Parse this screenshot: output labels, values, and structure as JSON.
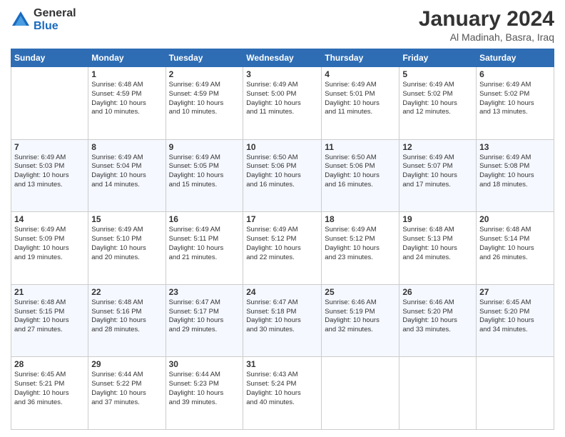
{
  "header": {
    "logo_general": "General",
    "logo_blue": "Blue",
    "month_title": "January 2024",
    "subtitle": "Al Madinah, Basra, Iraq"
  },
  "days_of_week": [
    "Sunday",
    "Monday",
    "Tuesday",
    "Wednesday",
    "Thursday",
    "Friday",
    "Saturday"
  ],
  "weeks": [
    [
      {
        "day": "",
        "lines": []
      },
      {
        "day": "1",
        "lines": [
          "Sunrise: 6:48 AM",
          "Sunset: 4:59 PM",
          "Daylight: 10 hours",
          "and 10 minutes."
        ]
      },
      {
        "day": "2",
        "lines": [
          "Sunrise: 6:49 AM",
          "Sunset: 4:59 PM",
          "Daylight: 10 hours",
          "and 10 minutes."
        ]
      },
      {
        "day": "3",
        "lines": [
          "Sunrise: 6:49 AM",
          "Sunset: 5:00 PM",
          "Daylight: 10 hours",
          "and 11 minutes."
        ]
      },
      {
        "day": "4",
        "lines": [
          "Sunrise: 6:49 AM",
          "Sunset: 5:01 PM",
          "Daylight: 10 hours",
          "and 11 minutes."
        ]
      },
      {
        "day": "5",
        "lines": [
          "Sunrise: 6:49 AM",
          "Sunset: 5:02 PM",
          "Daylight: 10 hours",
          "and 12 minutes."
        ]
      },
      {
        "day": "6",
        "lines": [
          "Sunrise: 6:49 AM",
          "Sunset: 5:02 PM",
          "Daylight: 10 hours",
          "and 13 minutes."
        ]
      }
    ],
    [
      {
        "day": "7",
        "lines": [
          "Sunrise: 6:49 AM",
          "Sunset: 5:03 PM",
          "Daylight: 10 hours",
          "and 13 minutes."
        ]
      },
      {
        "day": "8",
        "lines": [
          "Sunrise: 6:49 AM",
          "Sunset: 5:04 PM",
          "Daylight: 10 hours",
          "and 14 minutes."
        ]
      },
      {
        "day": "9",
        "lines": [
          "Sunrise: 6:49 AM",
          "Sunset: 5:05 PM",
          "Daylight: 10 hours",
          "and 15 minutes."
        ]
      },
      {
        "day": "10",
        "lines": [
          "Sunrise: 6:50 AM",
          "Sunset: 5:06 PM",
          "Daylight: 10 hours",
          "and 16 minutes."
        ]
      },
      {
        "day": "11",
        "lines": [
          "Sunrise: 6:50 AM",
          "Sunset: 5:06 PM",
          "Daylight: 10 hours",
          "and 16 minutes."
        ]
      },
      {
        "day": "12",
        "lines": [
          "Sunrise: 6:49 AM",
          "Sunset: 5:07 PM",
          "Daylight: 10 hours",
          "and 17 minutes."
        ]
      },
      {
        "day": "13",
        "lines": [
          "Sunrise: 6:49 AM",
          "Sunset: 5:08 PM",
          "Daylight: 10 hours",
          "and 18 minutes."
        ]
      }
    ],
    [
      {
        "day": "14",
        "lines": [
          "Sunrise: 6:49 AM",
          "Sunset: 5:09 PM",
          "Daylight: 10 hours",
          "and 19 minutes."
        ]
      },
      {
        "day": "15",
        "lines": [
          "Sunrise: 6:49 AM",
          "Sunset: 5:10 PM",
          "Daylight: 10 hours",
          "and 20 minutes."
        ]
      },
      {
        "day": "16",
        "lines": [
          "Sunrise: 6:49 AM",
          "Sunset: 5:11 PM",
          "Daylight: 10 hours",
          "and 21 minutes."
        ]
      },
      {
        "day": "17",
        "lines": [
          "Sunrise: 6:49 AM",
          "Sunset: 5:12 PM",
          "Daylight: 10 hours",
          "and 22 minutes."
        ]
      },
      {
        "day": "18",
        "lines": [
          "Sunrise: 6:49 AM",
          "Sunset: 5:12 PM",
          "Daylight: 10 hours",
          "and 23 minutes."
        ]
      },
      {
        "day": "19",
        "lines": [
          "Sunrise: 6:48 AM",
          "Sunset: 5:13 PM",
          "Daylight: 10 hours",
          "and 24 minutes."
        ]
      },
      {
        "day": "20",
        "lines": [
          "Sunrise: 6:48 AM",
          "Sunset: 5:14 PM",
          "Daylight: 10 hours",
          "and 26 minutes."
        ]
      }
    ],
    [
      {
        "day": "21",
        "lines": [
          "Sunrise: 6:48 AM",
          "Sunset: 5:15 PM",
          "Daylight: 10 hours",
          "and 27 minutes."
        ]
      },
      {
        "day": "22",
        "lines": [
          "Sunrise: 6:48 AM",
          "Sunset: 5:16 PM",
          "Daylight: 10 hours",
          "and 28 minutes."
        ]
      },
      {
        "day": "23",
        "lines": [
          "Sunrise: 6:47 AM",
          "Sunset: 5:17 PM",
          "Daylight: 10 hours",
          "and 29 minutes."
        ]
      },
      {
        "day": "24",
        "lines": [
          "Sunrise: 6:47 AM",
          "Sunset: 5:18 PM",
          "Daylight: 10 hours",
          "and 30 minutes."
        ]
      },
      {
        "day": "25",
        "lines": [
          "Sunrise: 6:46 AM",
          "Sunset: 5:19 PM",
          "Daylight: 10 hours",
          "and 32 minutes."
        ]
      },
      {
        "day": "26",
        "lines": [
          "Sunrise: 6:46 AM",
          "Sunset: 5:20 PM",
          "Daylight: 10 hours",
          "and 33 minutes."
        ]
      },
      {
        "day": "27",
        "lines": [
          "Sunrise: 6:45 AM",
          "Sunset: 5:20 PM",
          "Daylight: 10 hours",
          "and 34 minutes."
        ]
      }
    ],
    [
      {
        "day": "28",
        "lines": [
          "Sunrise: 6:45 AM",
          "Sunset: 5:21 PM",
          "Daylight: 10 hours",
          "and 36 minutes."
        ]
      },
      {
        "day": "29",
        "lines": [
          "Sunrise: 6:44 AM",
          "Sunset: 5:22 PM",
          "Daylight: 10 hours",
          "and 37 minutes."
        ]
      },
      {
        "day": "30",
        "lines": [
          "Sunrise: 6:44 AM",
          "Sunset: 5:23 PM",
          "Daylight: 10 hours",
          "and 39 minutes."
        ]
      },
      {
        "day": "31",
        "lines": [
          "Sunrise: 6:43 AM",
          "Sunset: 5:24 PM",
          "Daylight: 10 hours",
          "and 40 minutes."
        ]
      },
      {
        "day": "",
        "lines": []
      },
      {
        "day": "",
        "lines": []
      },
      {
        "day": "",
        "lines": []
      }
    ]
  ]
}
